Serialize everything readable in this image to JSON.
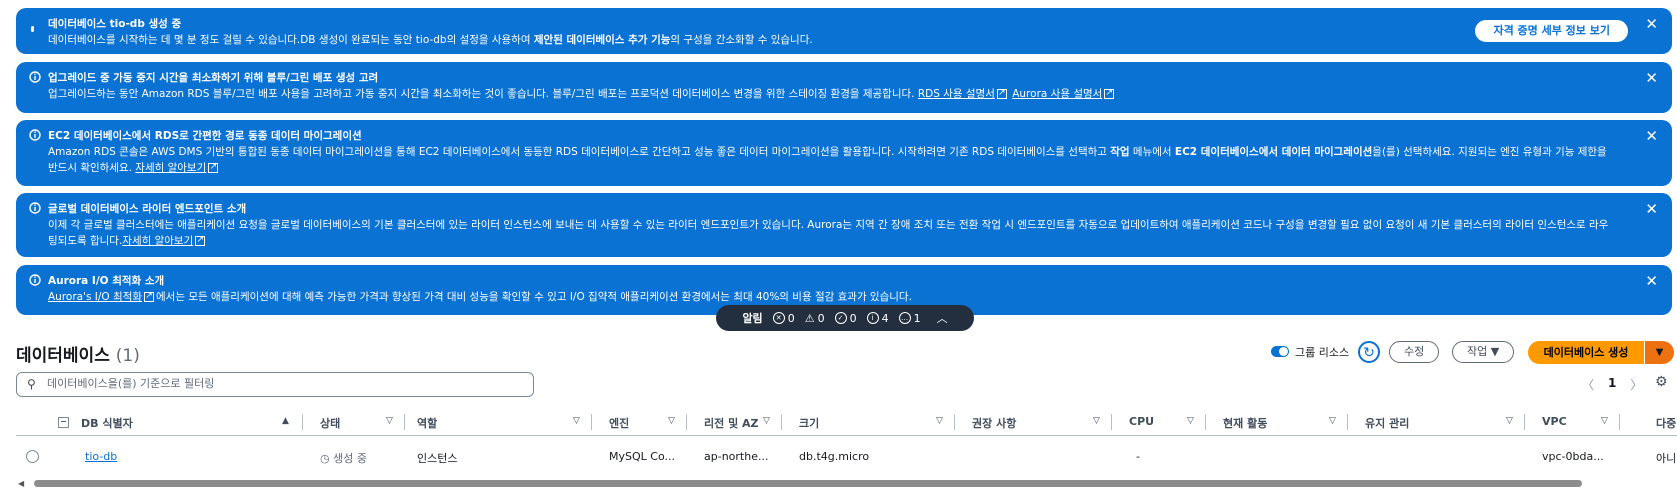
{
  "flashes": [
    {
      "title": "데이터베이스 tio-db 생성 중",
      "body_pre": "데이터베이스를 시작하는 데 몇 분 정도 걸릴 수 있습니다.DB 생성이 완료되는 동안 tio-db의 설정을 사용하여 ",
      "body_bold": "제안된 데이터베이스 추가 기능",
      "body_post": "의 구성을 간소화할 수 있습니다.",
      "button": "자격 증명 세부 정보 보기"
    },
    {
      "title": "업그레이드 중 가동 중지 시간을 최소화하기 위해 블루/그린 배포 생성 고려",
      "body": "업그레이드하는 동안 Amazon RDS 블루/그린 배포 사용을 고려하고 가동 중지 시간을 최소화하는 것이 좋습니다. 블루/그린 배포는 프로덕션 데이터베이스 변경을 위한 스테이징 환경을 제공합니다. ",
      "link1": "RDS 사용 설명서",
      "link2": "Aurora 사용 설명서"
    },
    {
      "title": "EC2 데이터베이스에서 RDS로 간편한 경로 동종 데이터 마이그레이션",
      "body_pre": "Amazon RDS 콘솔은 AWS DMS 기반의 통합된 동종 데이터 마이그레이션을 통해 EC2 데이터베이스에서 동등한 RDS 데이터베이스로 간단하고 성능 좋은 데이터 마이그레이션을 활용합니다. 시작하려면 기존 RDS 데이터베이스를 선택하고 ",
      "bold1": "작업",
      "mid": " 메뉴에서 ",
      "bold2": "EC2 데이터베이스에서 데이터 마이그레이션",
      "body_post": "을(를) 선택하세요. 지원되는 엔진 유형과 기능 제한을 반드시 확인하세요. ",
      "link": "자세히 알아보기"
    },
    {
      "title": "글로벌 데이터베이스 라이터 엔드포인트 소개",
      "body": "이제 각 글로벌 클러스터에는 애플리케이션 요청을 글로벌 데이터베이스의 기본 클러스터에 있는 라이터 인스턴스에 보내는 데 사용할 수 있는 라이터 엔드포인트가 있습니다. Aurora는 지역 간 장애 조치 또는 전환 작업 시 엔드포인트를 자동으로 업데이트하여 애플리케이션 코드나 구성을 변경할 필요 없이 요청이 새 기본 클러스터의 라이터 인스턴스로 라우팅되도록 합니다.",
      "link": "자세히 알아보기"
    },
    {
      "title": "Aurora I/O 최적화 소개",
      "link": "Aurora's I/O 최적화",
      "body": "에서는 모든 애플리케이션에 대해 예측 가능한 가격과 향상된 가격 대비 성능을 확인할 수 있고 I/O 집약적 애플리케이션 환경에서는 최대 40%의 비용 절감 효과가 있습니다."
    }
  ],
  "notifications": {
    "label": "알림",
    "error": "0",
    "warning": "0",
    "success": "0",
    "info": "4",
    "in_progress": "1"
  },
  "databases": {
    "title": "데이터베이스",
    "count": "(1)",
    "group_resources": "그룹 리소스",
    "modify": "수정",
    "actions": "작업",
    "create": "데이터베이스 생성",
    "filter_placeholder": "데이터베이스을(를) 기준으로 필터링",
    "page": "1"
  },
  "columns": [
    "DB 식별자",
    "상태",
    "역할",
    "엔진",
    "리전 및 AZ",
    "크기",
    "권장 사항",
    "CPU",
    "현재 활동",
    "유지 관리",
    "VPC",
    "다중"
  ],
  "rows": [
    {
      "id": "tio-db",
      "status": "생성 중",
      "role": "인스턴스",
      "engine": "MySQL Co...",
      "region": "ap-northe...",
      "size": "db.t4g.micro",
      "recommendation": "",
      "cpu": "-",
      "activity": "",
      "maintenance": "",
      "vpc": "vpc-0bda...",
      "multi": "아니"
    }
  ],
  "colors": {
    "flash": "#0972d3",
    "primary": "#ff9900",
    "notif": "#232f3e"
  }
}
